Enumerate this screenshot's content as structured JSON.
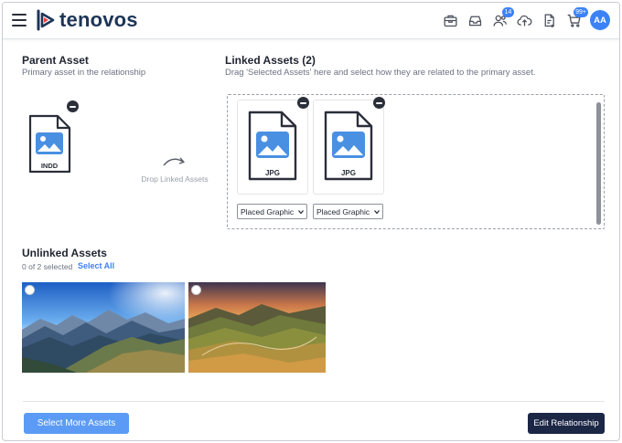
{
  "header": {
    "brand": "tenovos",
    "notifications_badge": "14",
    "cart_badge": "99+",
    "avatar_initials": "AA",
    "icons": [
      "menu-icon",
      "briefcase-icon",
      "inbox-icon",
      "users-icon",
      "upload-icon",
      "document-export-icon",
      "cart-icon"
    ]
  },
  "parent": {
    "title": "Parent Asset",
    "subtitle": "Primary asset in the relationship",
    "file_type": "INDD"
  },
  "drop_hint": "Drop Linked Assets",
  "linked": {
    "title": "Linked Assets (2)",
    "subtitle": "Drag 'Selected Assets' here and select how they are related to the primary asset.",
    "items": [
      {
        "file_type": "JPG",
        "relation": "Placed Graphic"
      },
      {
        "file_type": "JPG",
        "relation": "Placed Graphic"
      }
    ]
  },
  "unlinked": {
    "title": "Unlinked Assets",
    "count": "0 of 2 selected",
    "select_all": "Select All"
  },
  "footer": {
    "select_more": "Select More Assets",
    "edit_relationship": "Edit Relationship"
  },
  "colors": {
    "accent": "#3b82f6",
    "brand_navy": "#1d3557",
    "dark_button": "#1c2746",
    "file_icon_blue": "#4a90e2"
  }
}
